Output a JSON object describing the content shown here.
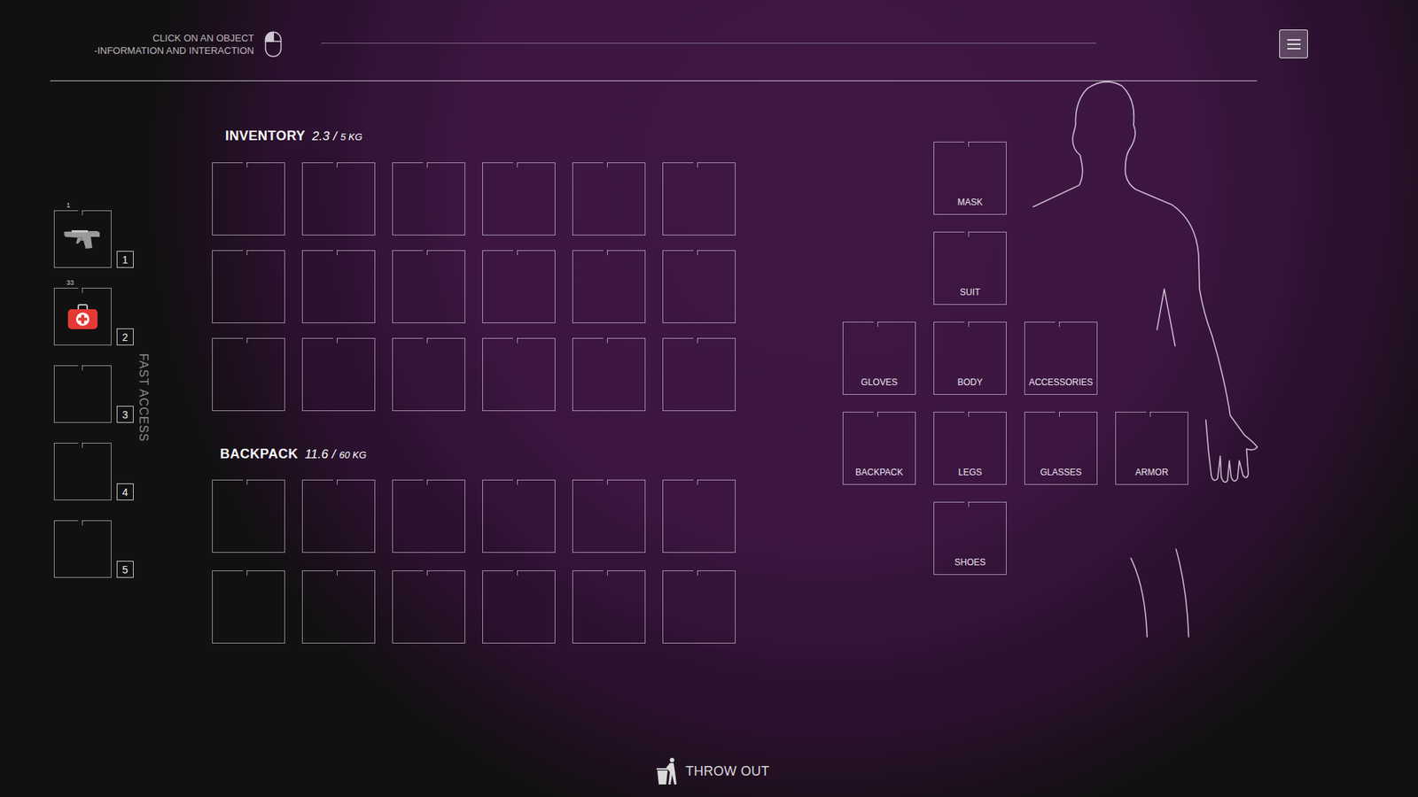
{
  "header": {
    "hint": [
      "CLICK ON AN OBJECT",
      "-INFORMATION AND INTERACTION"
    ]
  },
  "fast_access": {
    "label": "FAST ACCESS",
    "slots": [
      {
        "key": "1",
        "count": "1",
        "kind": "pistol"
      },
      {
        "key": "2",
        "count": "33",
        "kind": "medkit"
      },
      {
        "key": "3",
        "kind": "empty"
      },
      {
        "key": "4",
        "kind": "empty"
      },
      {
        "key": "5",
        "kind": "empty"
      }
    ]
  },
  "inventory": {
    "title": "INVENTORY",
    "weight": "2.3",
    "separator": "/",
    "capacity": "5 KG",
    "slots": [
      {
        "filled": false
      },
      {
        "filled": false
      },
      {
        "filled": false
      },
      {
        "filled": false
      },
      {
        "filled": false
      },
      {
        "filled": false
      },
      {
        "filled": false
      },
      {
        "filled": false
      },
      {
        "filled": false
      },
      {
        "filled": false
      },
      {
        "filled": false
      },
      {
        "filled": false
      },
      {
        "filled": false
      },
      {
        "filled": false
      },
      {
        "filled": false
      },
      {
        "filled": false
      },
      {
        "filled": false
      },
      {
        "filled": false
      }
    ]
  },
  "backpack": {
    "title": "BACKPACK",
    "weight": "11.6",
    "separator": "/",
    "capacity": "60 KG",
    "slots": [
      {
        "filled": false
      },
      {
        "filled": false
      },
      {
        "filled": false
      },
      {
        "filled": false
      },
      {
        "filled": false
      },
      {
        "filled": false
      },
      {
        "filled": false
      },
      {
        "filled": false
      },
      {
        "filled": false
      },
      {
        "filled": false
      },
      {
        "filled": false
      },
      {
        "filled": false
      }
    ]
  },
  "equipment": [
    {
      "label": "MASK"
    },
    {
      "label": "SUIT"
    },
    {
      "label": "GLOVES"
    },
    {
      "label": "BODY"
    },
    {
      "label": "ACCESSORIES"
    },
    {
      "label": "BACKPACK"
    },
    {
      "label": "LEGS"
    },
    {
      "label": "GLASSES"
    },
    {
      "label": "ARMOR"
    },
    {
      "label": "SHOES"
    }
  ],
  "throw_out": {
    "label": "THROW OUT"
  }
}
